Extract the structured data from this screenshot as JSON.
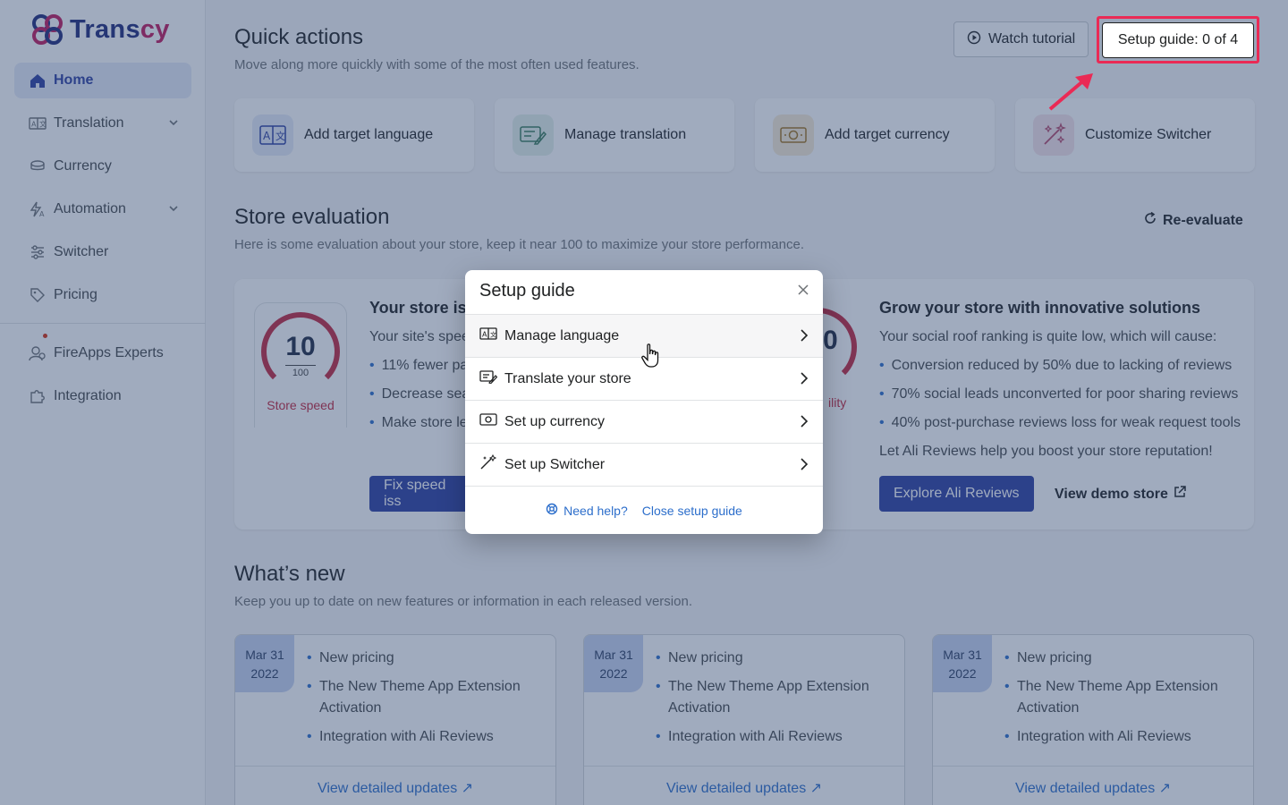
{
  "app": {
    "brand_prefix": "Trans",
    "brand_accent": "cy"
  },
  "sidebar": {
    "items": [
      {
        "label": "Home",
        "icon": "home-icon"
      },
      {
        "label": "Translation",
        "icon": "translate-icon"
      },
      {
        "label": "Currency",
        "icon": "coins-icon"
      },
      {
        "label": "Automation",
        "icon": "automation-icon"
      },
      {
        "label": "Switcher",
        "icon": "sliders-icon"
      },
      {
        "label": "Pricing",
        "icon": "tag-icon"
      }
    ],
    "secondary": [
      {
        "label": "FireApps Experts",
        "icon": "experts-icon"
      },
      {
        "label": "Integration",
        "icon": "puzzle-icon"
      }
    ]
  },
  "quick_actions": {
    "title": "Quick actions",
    "subtitle": "Move along more quickly with some of the most often used features.",
    "watch_tutorial": "Watch tutorial",
    "setup_guide_btn": "Setup guide: 0 of 4",
    "cards": [
      {
        "label": "Add target language"
      },
      {
        "label": "Manage translation"
      },
      {
        "label": "Add target currency"
      },
      {
        "label": "Customize Switcher"
      }
    ]
  },
  "store_eval": {
    "title": "Store evaluation",
    "subtitle": "Here is some evaluation about your store, keep it near 100 to maximize your store performance.",
    "reevaluate": "Re-evaluate",
    "speed": {
      "score": "10",
      "max": "100",
      "label": "Store speed",
      "heading": "Your store is s",
      "intro": "Your site's spee",
      "bullets": [
        "11% fewer pa",
        "Decrease sear",
        "Make store le"
      ],
      "button": "Fix speed iss"
    },
    "social": {
      "score_partial": "0",
      "label_partial": "ility",
      "heading": "Grow your store with innovative solutions",
      "intro": "Your social roof ranking is quite low, which will cause:",
      "bullets": [
        "Conversion reduced by 50% due to lacking of reviews",
        "70% social leads unconverted for poor sharing reviews",
        "40% post-purchase reviews loss for weak request tools"
      ],
      "cta_text": "Let Ali Reviews help you boost your store reputation!",
      "button": "Explore Ali Reviews",
      "demo_link": "View demo store"
    }
  },
  "whats_new": {
    "title": "What’s new",
    "subtitle": "Keep you up to date on new features or information in each released version.",
    "cards": [
      {
        "date_md": "Mar 31",
        "date_y": "2022",
        "items": [
          "New pricing",
          "The New Theme App Extension Activation",
          "Integration with Ali Reviews"
        ],
        "link": "View detailed updates"
      },
      {
        "date_md": "Mar 31",
        "date_y": "2022",
        "items": [
          "New pricing",
          "The New Theme App Extension Activation",
          "Integration with Ali Reviews"
        ],
        "link": "View detailed updates"
      },
      {
        "date_md": "Mar 31",
        "date_y": "2022",
        "items": [
          "New pricing",
          "The New Theme App Extension Activation",
          "Integration with Ali Reviews"
        ],
        "link": "View detailed updates"
      }
    ]
  },
  "modal": {
    "title": "Setup guide",
    "rows": [
      {
        "label": "Manage language",
        "icon": "language-icon"
      },
      {
        "label": "Translate your store",
        "icon": "translate-store-icon"
      },
      {
        "label": "Set up currency",
        "icon": "currency-icon"
      },
      {
        "label": "Set up Switcher",
        "icon": "magic-wand-icon"
      }
    ],
    "need_help": "Need help?",
    "close_guide": "Close setup guide"
  },
  "colors": {
    "brand": "#2c3ea0",
    "accent": "#c2185b",
    "highlight": "#ea2a55",
    "link": "#2c6ecb"
  }
}
